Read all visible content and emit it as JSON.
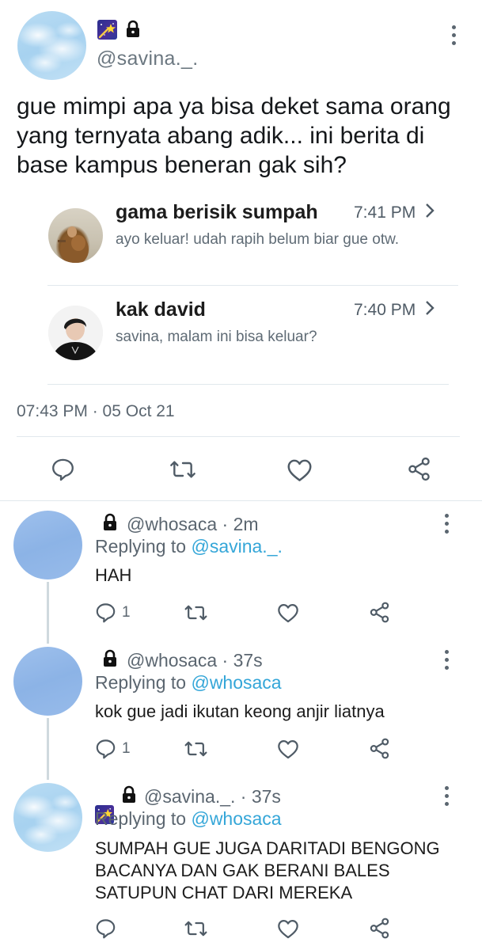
{
  "main_tweet": {
    "handle": "@savina._.",
    "text": "gue mimpi apa ya bisa deket sama orang yang ternyata abang adik... ini berita di base kampus beneran gak sih?",
    "timestamp": "07:43 PM · 05 Oct 21",
    "icons": [
      "shooting-star-emoji",
      "lock-icon",
      "more-icon"
    ],
    "quoted_chats": [
      {
        "name": "gama berisik sumpah",
        "time": "7:41 PM",
        "message": "ayo keluar! udah rapih belum biar gue otw."
      },
      {
        "name": "kak david",
        "time": "7:40 PM",
        "message": "savina, malam ini bisa keluar?"
      }
    ],
    "actions": [
      "reply-icon",
      "retweet-icon",
      "like-icon",
      "share-icon"
    ]
  },
  "replies": [
    {
      "handle": "@whosaca",
      "time": "· 2m",
      "replying_label": "Replying to",
      "replying_to": "@savina._.",
      "text": "HAH",
      "reply_count": "1"
    },
    {
      "handle": "@whosaca",
      "time": "· 37s",
      "replying_label": "Replying to",
      "replying_to": "@whosaca",
      "text": "kok gue jadi ikutan keong anjir liatnya",
      "reply_count": "1"
    },
    {
      "handle": "@savina._.",
      "time": "· 37s",
      "replying_label": "Replying to",
      "replying_to": "@whosaca",
      "text_lines": [
        "SUMPAH GUE JUGA DARITADI BENGONG",
        "BACANYA DAN GAK BERANI BALES",
        "SATUPUN CHAT DARI MEREKA"
      ],
      "reply_count": ""
    }
  ],
  "colors": {
    "link": "#34a6d8",
    "muted": "#657786",
    "divider": "#e1e8ed"
  }
}
